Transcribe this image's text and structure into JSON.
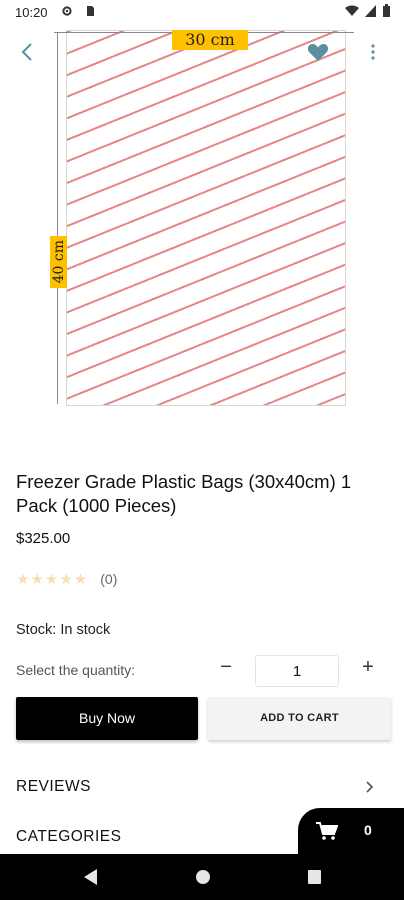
{
  "status_bar": {
    "time": "10:20",
    "icons": [
      "settings-icon",
      "sim-icon",
      "wifi-icon",
      "signal-icon",
      "battery-icon"
    ]
  },
  "product_image": {
    "width_label": "30 cm",
    "height_label": "40 cm"
  },
  "header": {
    "icons": [
      "back-arrow-icon",
      "heart-icon",
      "more-vert-icon"
    ],
    "accent": "#5a8fa0"
  },
  "product": {
    "title": "Freezer Grade Plastic Bags (30x40cm) 1 Pack (1000 Pieces)",
    "price": "$325.00",
    "rating": {
      "stars": 0,
      "max": 5,
      "count": "(0)"
    },
    "stock": "Stock: In stock"
  },
  "quantity": {
    "label": "Select the quantity:",
    "minus": "−",
    "value": "1",
    "plus": "+"
  },
  "actions": {
    "buy_now": "Buy Now",
    "add_to_cart": "ADD TO CART"
  },
  "sections": {
    "reviews": "REVIEWS",
    "categories": "CATEGORIES"
  },
  "cart": {
    "count": "0"
  }
}
